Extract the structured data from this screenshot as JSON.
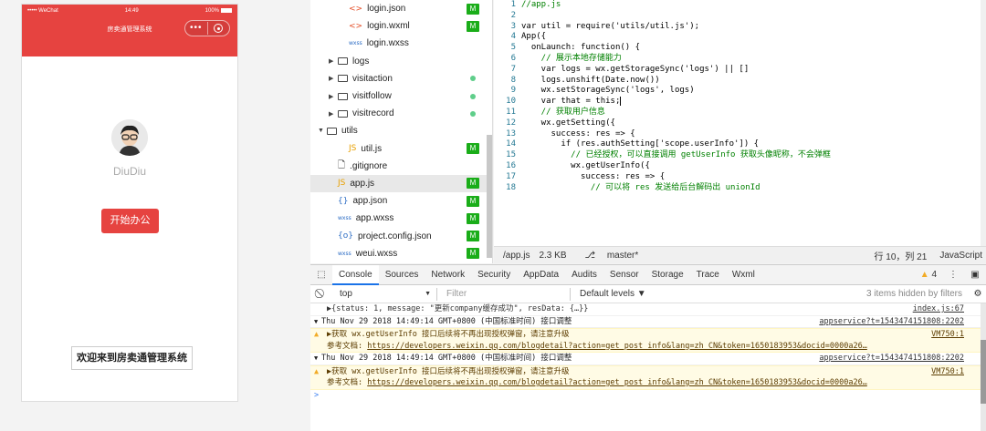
{
  "simulator": {
    "carrier": "••••• WeChat",
    "time": "14:49",
    "battery": "100%",
    "nav_title": "房卖通管理系统",
    "capsule_dots": "•••",
    "nickname": "DiuDiu",
    "start_button": "开始办公",
    "welcome_text": "欢迎来到房卖通管理系统",
    "accent_color": "#e64340"
  },
  "file_tree": [
    {
      "type": "wxml",
      "icon": "<>",
      "name": "login.json",
      "badge": "M",
      "indent": 2
    },
    {
      "type": "wxml",
      "icon": "<>",
      "name": "login.wxml",
      "badge": "M",
      "indent": 2
    },
    {
      "type": "wxss",
      "icon": "wxss",
      "name": "login.wxss",
      "badge": "",
      "indent": 2
    },
    {
      "type": "folder",
      "icon": "folder-icon",
      "name": "logs",
      "badge": "",
      "indent": 1
    },
    {
      "type": "folder",
      "icon": "folder-icon",
      "name": "visitaction",
      "badge": "dot",
      "indent": 1
    },
    {
      "type": "folder",
      "icon": "folder-icon",
      "name": "visitfollow",
      "badge": "dot",
      "indent": 1
    },
    {
      "type": "folder",
      "icon": "folder-icon",
      "name": "visitrecord",
      "badge": "dot",
      "indent": 1
    },
    {
      "type": "folder-open",
      "icon": "folder-open-icon",
      "name": "utils",
      "badge": "",
      "indent": 0
    },
    {
      "type": "js",
      "icon": "JS",
      "name": "util.js",
      "badge": "M",
      "indent": 2
    },
    {
      "type": "file",
      "icon": "file-icon",
      "name": ".gitignore",
      "badge": "",
      "indent": 1
    },
    {
      "type": "js",
      "icon": "JS",
      "name": "app.js",
      "badge": "M",
      "indent": 1,
      "selected": true
    },
    {
      "type": "json",
      "icon": "{}",
      "name": "app.json",
      "badge": "M",
      "indent": 1
    },
    {
      "type": "wxss",
      "icon": "wxss",
      "name": "app.wxss",
      "badge": "M",
      "indent": 1
    },
    {
      "type": "json",
      "icon": "{o}",
      "name": "project.config.json",
      "badge": "M",
      "indent": 1
    },
    {
      "type": "wxss",
      "icon": "wxss",
      "name": "weui.wxss",
      "badge": "M",
      "indent": 1
    }
  ],
  "editor": {
    "lines": [
      {
        "n": "1",
        "text": "//app.js",
        "kind": "cm"
      },
      {
        "n": "2",
        "text": "",
        "kind": ""
      },
      {
        "n": "3",
        "text": "var util = require('utils/util.js');",
        "kind": "code"
      },
      {
        "n": "4",
        "text": "App({",
        "kind": "code"
      },
      {
        "n": "5",
        "text": "  onLaunch: function() {",
        "kind": "code"
      },
      {
        "n": "6",
        "text": "    // 展示本地存储能力",
        "kind": "cm"
      },
      {
        "n": "7",
        "text": "    var logs = wx.getStorageSync('logs') || []",
        "kind": "code"
      },
      {
        "n": "8",
        "text": "    logs.unshift(Date.now())",
        "kind": "code"
      },
      {
        "n": "9",
        "text": "    wx.setStorageSync('logs', logs)",
        "kind": "code"
      },
      {
        "n": "10",
        "text": "    var that = this;",
        "kind": "code"
      },
      {
        "n": "11",
        "text": "    // 获取用户信息",
        "kind": "cm"
      },
      {
        "n": "12",
        "text": "    wx.getSetting({",
        "kind": "code"
      },
      {
        "n": "13",
        "text": "      success: res => {",
        "kind": "code"
      },
      {
        "n": "14",
        "text": "        if (res.authSetting['scope.userInfo']) {",
        "kind": "code"
      },
      {
        "n": "15",
        "text": "          // 已经授权，可以直接调用 getUserInfo 获取头像昵称，不会弹框",
        "kind": "cm"
      },
      {
        "n": "16",
        "text": "          wx.getUserInfo({",
        "kind": "code"
      },
      {
        "n": "17",
        "text": "            success: res => {",
        "kind": "code"
      },
      {
        "n": "18",
        "text": "              // 可以将 res 发送给后台解码出 unionId",
        "kind": "cm"
      }
    ]
  },
  "status_bar": {
    "path": "/app.js",
    "size": "2.3 KB",
    "branch": "master*",
    "position": "行 10，列 21",
    "language": "JavaScript"
  },
  "devtools": {
    "tabs": [
      "Console",
      "Sources",
      "Network",
      "Security",
      "AppData",
      "Audits",
      "Sensor",
      "Storage",
      "Trace",
      "Wxml"
    ],
    "active_tab": "Console",
    "warning_count": "4",
    "context": "top",
    "filter_placeholder": "Filter",
    "levels": "Default levels ▼",
    "hidden_note": "3 items hidden by filters"
  },
  "console": [
    {
      "kind": "object",
      "text": "▶{status: 1, message: \"更新company缓存成功\", resData: {…}}",
      "src": "index.js:67"
    },
    {
      "kind": "group",
      "text": "Thu Nov 29 2018 14:49:14 GMT+0800 (中国标准时间) 接口调整",
      "src": "appservice?t=1543474151808:2202"
    },
    {
      "kind": "warn",
      "text": "▶获取 wx.getUserInfo 接口后续将不再出现授权弹窗，请注意升级",
      "src": "VM750:1",
      "link_label": "参考文档: ",
      "link": "https://developers.weixin.qq.com/blogdetail?action=get_post_info&lang=zh_CN&token=1650183953&docid=0000a26…"
    },
    {
      "kind": "group",
      "text": "Thu Nov 29 2018 14:49:14 GMT+0800 (中国标准时间) 接口调整",
      "src": "appservice?t=1543474151808:2202"
    },
    {
      "kind": "warn",
      "text": "▶获取 wx.getUserInfo 接口后续将不再出现授权弹窗，请注意升级",
      "src": "VM750:1",
      "link_label": "参考文档: ",
      "link": "https://developers.weixin.qq.com/blogdetail?action=get_post_info&lang=zh_CN&token=1650183953&docid=0000a26…"
    }
  ],
  "console_prompt": ">"
}
